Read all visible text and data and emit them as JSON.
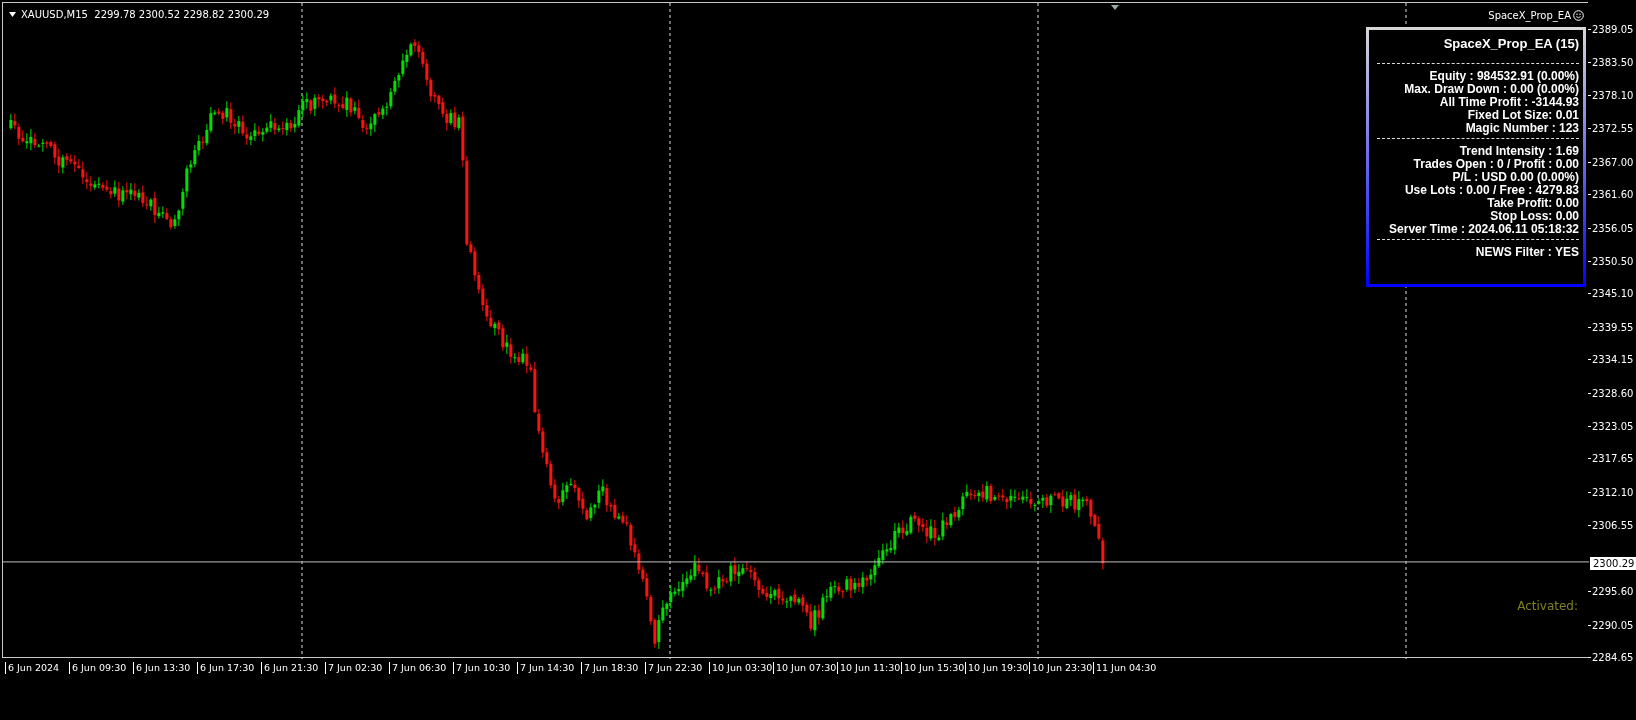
{
  "chart_header": {
    "symbol_line": "XAUUSD,M15  2299.78 2300.52 2298.82 2300.29"
  },
  "expert_label": "SpaceX_Prop_EA",
  "info_panel": {
    "title": "SpaceX_Prop_EA (15)",
    "sections": [
      [
        "Equity : 984532.91 (0.00%)",
        "Max. Draw Down : 0.00 (0.00%)",
        "All Time Profit : -3144.93",
        "Fixed Lot Size: 0.01",
        "Magic Number : 123"
      ],
      [
        "Trend Intensity : 1.69",
        "Trades Open : 0 / Profit : 0.00",
        "P/L : USD 0.00 (0.00%)",
        "Use Lots : 0.00 / Free : 4279.83",
        "Take Profit: 0.00",
        "Stop Loss: 0.00",
        "Server Time : 2024.06.11 05:18:32"
      ],
      [
        "NEWS Filter : YES"
      ]
    ]
  },
  "status_text": "Activated:",
  "price_axis": [
    "2389.05",
    "2383.50",
    "2378.10",
    "2372.55",
    "2367.00",
    "2361.60",
    "2356.05",
    "2350.50",
    "2345.10",
    "2339.55",
    "2334.15",
    "2328.60",
    "2323.05",
    "2317.65",
    "2312.10",
    "2306.55",
    "2295.60",
    "2290.05",
    "2284.65"
  ],
  "current_price": "2300.29",
  "time_axis": [
    "6 Jun 2024",
    "6 Jun 09:30",
    "6 Jun 13:30",
    "6 Jun 17:30",
    "6 Jun 21:30",
    "7 Jun 02:30",
    "7 Jun 06:30",
    "7 Jun 10:30",
    "7 Jun 14:30",
    "7 Jun 18:30",
    "7 Jun 22:30",
    "10 Jun 03:30",
    "10 Jun 07:30",
    "10 Jun 11:30",
    "10 Jun 15:30",
    "10 Jun 19:30",
    "10 Jun 23:30",
    "11 Jun 04:30"
  ]
}
